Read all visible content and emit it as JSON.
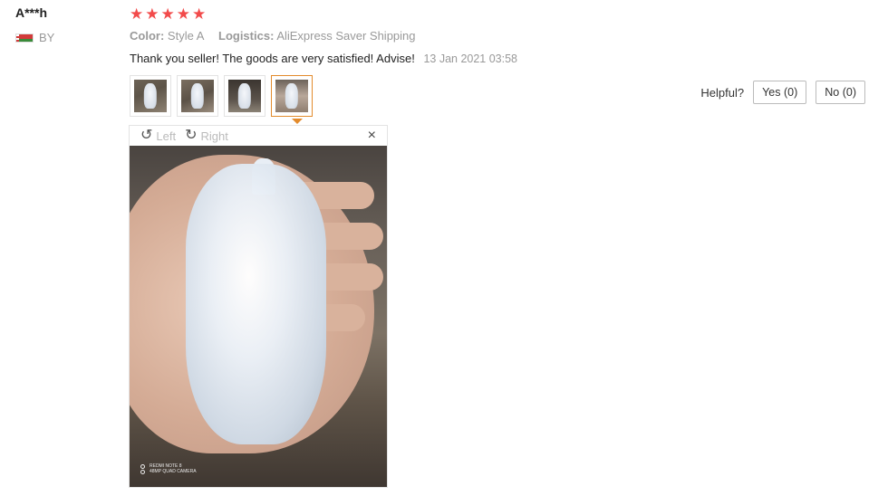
{
  "review": {
    "user_name": "A***h",
    "country_code": "BY",
    "rating": 5,
    "stars": [
      "★",
      "★",
      "★",
      "★",
      "★"
    ],
    "color_label": "Color:",
    "color_value": "Style A",
    "logistics_label": "Logistics:",
    "logistics_value": "AliExpress Saver Shipping",
    "feedback_text": "Thank you seller! The goods are very satisfied! Advise!",
    "date": "13 Jan 2021 03:58"
  },
  "viewer": {
    "rotate_left_label": "Left",
    "rotate_right_label": "Right",
    "rotate_left_icon": "↺",
    "rotate_right_icon": "↻",
    "close_icon": "×",
    "watermark_line1": "REDMI NOTE 8",
    "watermark_line2": "48MP QUAD CAMERA"
  },
  "helpful": {
    "label": "Helpful?",
    "yes_label": "Yes (0)",
    "no_label": "No (0)"
  },
  "colors": {
    "star": "#f24b4b",
    "active_thumb_border": "#e38b2c",
    "meta_text": "#999999"
  }
}
